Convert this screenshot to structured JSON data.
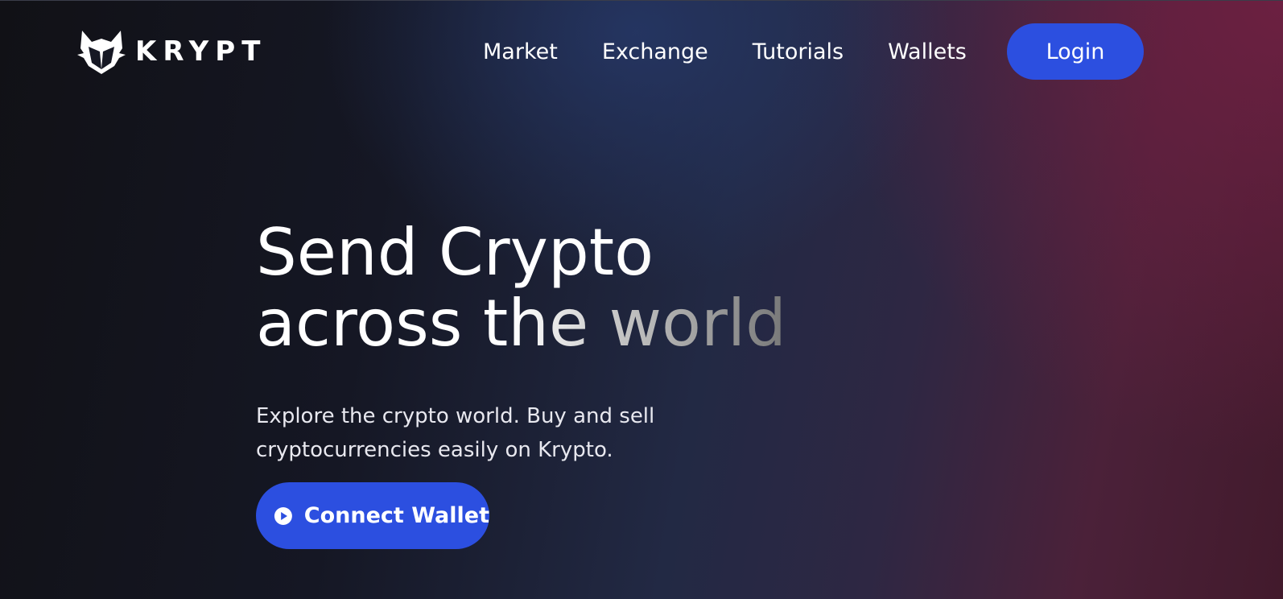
{
  "brand": {
    "logo_icon": "fox-icon",
    "name": "KRYPT"
  },
  "nav": {
    "items": [
      {
        "label": "Market"
      },
      {
        "label": "Exchange"
      },
      {
        "label": "Tutorials"
      },
      {
        "label": "Wallets"
      }
    ],
    "login_label": "Login"
  },
  "hero": {
    "title_line1": "Send Crypto",
    "title_line2": "across the world",
    "subtitle": "Explore the crypto world. Buy and sell cryptocurrencies easily on Krypto.",
    "cta": {
      "icon": "play-circle-icon",
      "label": "Connect Wallet"
    }
  },
  "colors": {
    "accent": "#2c4fe0",
    "background_dark": "#111116",
    "background_mid": "#222944",
    "background_right": "#6e2042"
  }
}
